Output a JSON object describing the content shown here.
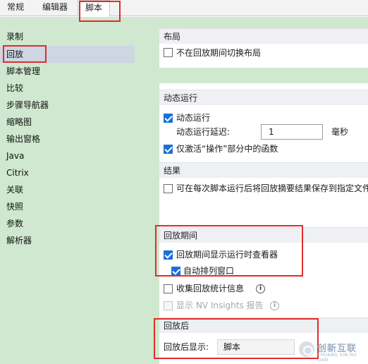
{
  "tabs": [
    {
      "label": "常规",
      "active": false
    },
    {
      "label": "编辑器",
      "active": false
    },
    {
      "label": "脚本",
      "active": true
    }
  ],
  "sidebar": {
    "items": [
      {
        "label": "录制"
      },
      {
        "label": "回放",
        "selected": true
      },
      {
        "label": "脚本管理"
      },
      {
        "label": "比较"
      },
      {
        "label": "步骤导航器"
      },
      {
        "label": "缩略图"
      },
      {
        "label": "输出窗格"
      },
      {
        "label": "Java"
      },
      {
        "label": "Citrix"
      },
      {
        "label": "关联"
      },
      {
        "label": "快照"
      },
      {
        "label": "参数"
      },
      {
        "label": "解析器"
      }
    ]
  },
  "sections": {
    "layout": {
      "title": "布局",
      "no_switch_layout": {
        "label": "不在回放期间切换布局",
        "checked": false
      }
    },
    "dynamic_run": {
      "title": "动态运行",
      "dynamic_run": {
        "label": "动态运行",
        "checked": true
      },
      "delay_label": "动态运行延迟:",
      "delay_value": "1",
      "delay_unit": "毫秒",
      "only_active": {
        "label": "仅激活“操作”部分中的函数",
        "checked": true
      }
    },
    "results": {
      "title": "结果",
      "save_summary": {
        "label": "可在每次脚本运行后将回放摘要结果保存到指定文件",
        "checked": false
      }
    },
    "during_replay": {
      "title": "回放期间",
      "show_viewer": {
        "label": "回放期间显示运行时查看器",
        "checked": true
      },
      "auto_arrange": {
        "label": "自动排列窗口",
        "checked": true
      },
      "collect_stats": {
        "label": "收集回放统计信息",
        "checked": false
      },
      "nv_insights": {
        "label": "显示 NV Insights 报告",
        "checked": false,
        "disabled": true
      }
    },
    "after_replay": {
      "title": "回放后",
      "show_label": "回放后显示:",
      "show_value": "脚本"
    }
  },
  "watermark": {
    "title": "创新互联",
    "subtitle": "CHUANG XIN HU LIAN"
  },
  "colors": {
    "highlight": "#e22c2c",
    "checkbox_checked": "#1a6fd8",
    "sidebar_bg": "#cfe8cf",
    "selected_bg": "#cdd6e2"
  }
}
